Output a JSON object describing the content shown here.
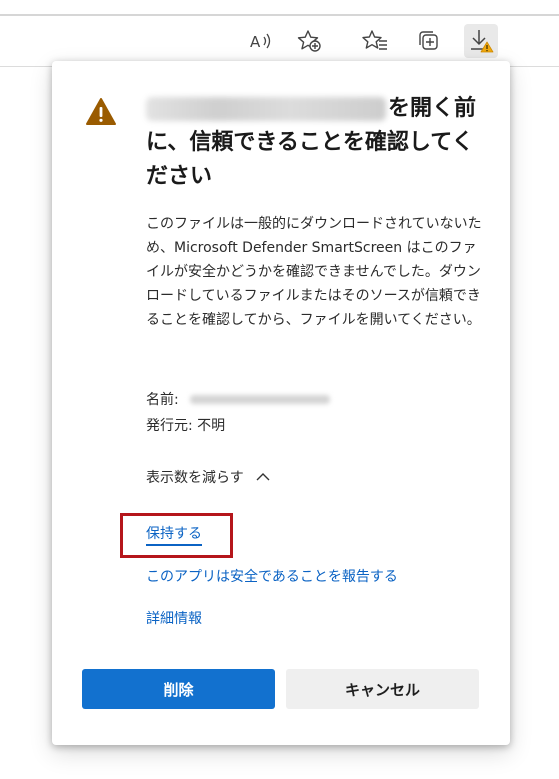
{
  "browser_toolbar": {
    "buttons": [
      {
        "icon": "read-aloud-icon"
      },
      {
        "icon": "add-favorite-icon"
      },
      {
        "icon": "favorites-icon"
      },
      {
        "icon": "collections-icon"
      },
      {
        "icon": "downloads-warning-icon"
      }
    ]
  },
  "dialog": {
    "title_suffix": "を開く前に、信頼できることを確認してください",
    "body": "このファイルは一般的にダウンロードされていないため、Microsoft Defender SmartScreen はこのファイルが安全かどうかを確認できませんでした。ダウンロードしているファイルまたはそのソースが信頼できることを確認してから、ファイルを開いてください。",
    "name_label": "名前:",
    "publisher_label": "発行元:",
    "publisher_value": "不明",
    "toggle_label": "表示数を減らす",
    "keep_link": "保持する",
    "report_link": "このアプリは安全であることを報告する",
    "details_link": "詳細情報",
    "delete_button": "削除",
    "cancel_button": "キャンセル"
  },
  "colors": {
    "primary_button": "#1271cf",
    "link": "#0b63c4",
    "warning": "#9a5b00",
    "highlight": "#b5161b"
  }
}
